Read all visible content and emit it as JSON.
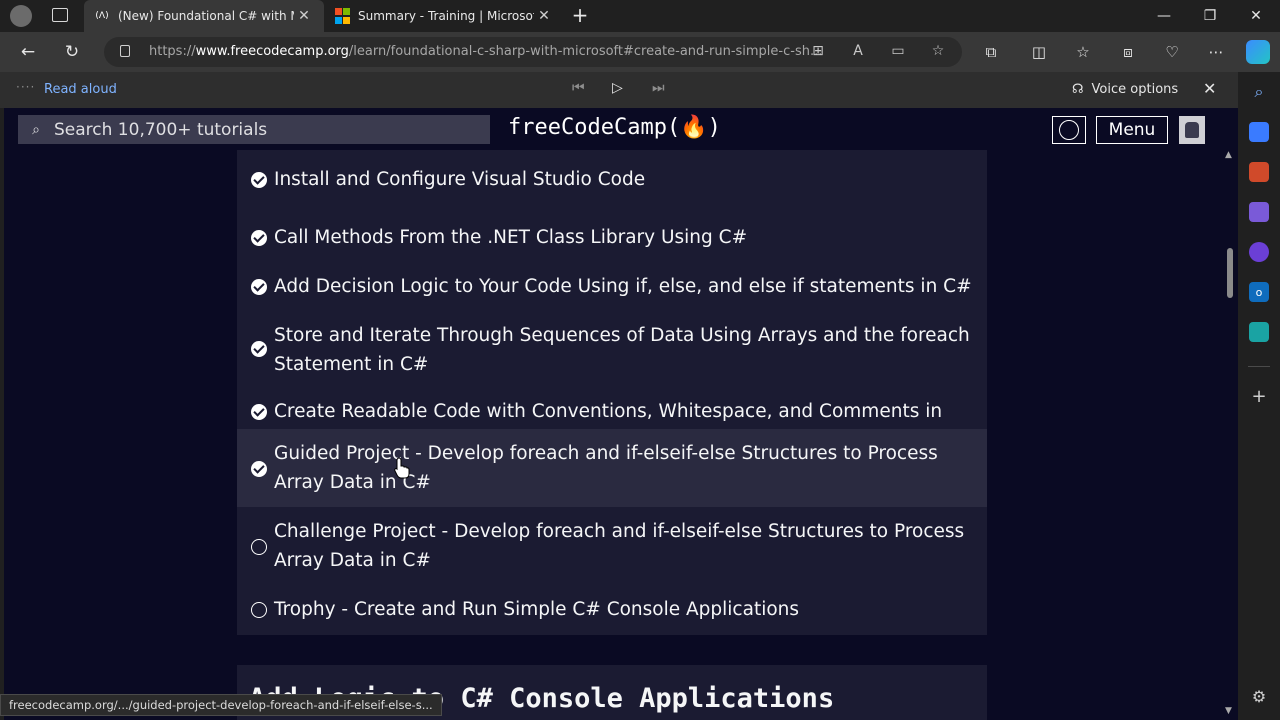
{
  "browser": {
    "tabs": [
      {
        "favicon": "(Λ)",
        "title": "(New) Foundational C# with Mic",
        "active": true
      },
      {
        "favicon": "ms-logo",
        "title": "Summary - Training | Microsoft L",
        "active": false
      }
    ],
    "new_tab_icon": "plus-icon",
    "url_prefix": "https://",
    "url_host": "www.freecodecamp.org",
    "url_path": "/learn/foundational-c-sharp-with-microsoft#create-and-run-simple-c-sh...",
    "read_aloud": {
      "label": "Read aloud",
      "voice_options": "Voice options"
    },
    "status_url": "freecodecamp.org/.../guided-project-develop-foreach-and-if-elseif-else-s..."
  },
  "fcc": {
    "search_placeholder": "Search 10,700+ tutorials",
    "logo": "freeCodeCamp(🔥)",
    "menu_label": "Menu",
    "items": [
      {
        "text": "Install and Configure Visual Studio Code",
        "done": true
      },
      {
        "text": "Call Methods From the .NET Class Library Using C#",
        "done": true
      },
      {
        "text": "Add Decision Logic to Your Code Using if, else, and else if statements in C#",
        "done": true
      },
      {
        "text": "Store and Iterate Through Sequences of Data Using Arrays and the foreach Statement in C#",
        "done": true
      },
      {
        "text": "Create Readable Code with Conventions, Whitespace, and Comments in C#",
        "done": true
      },
      {
        "text": "Guided Project - Develop foreach and if-elseif-else Structures to Process Array Data in C#",
        "done": true
      },
      {
        "text": "Challenge Project - Develop foreach and if-elseif-else Structures to Process Array Data in C#",
        "done": false
      },
      {
        "text": "Trophy - Create and Run Simple C# Console Applications",
        "done": false
      }
    ],
    "next_section_title": "Add Logic to C# Console Applications"
  },
  "colors": {
    "page_bg": "#0a0a23",
    "panel_bg": "#1b1b32",
    "highlight_bg": "#2a2a40",
    "accent_link": "#7fb3ff"
  }
}
